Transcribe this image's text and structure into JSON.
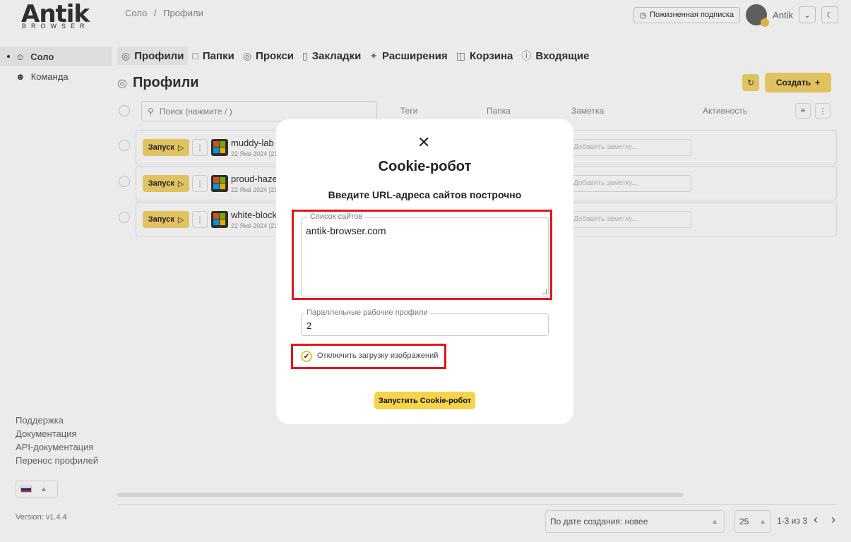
{
  "logo": {
    "word": "Antik",
    "sub": "BROWSER"
  },
  "breadcrumb": {
    "first": "Соло",
    "sep": "/",
    "second": "Профили"
  },
  "header": {
    "subscription_label": "Пожизненная подписка",
    "user_name": "Antik"
  },
  "sidebar": {
    "items": [
      {
        "label": "Соло",
        "icon": "user-icon"
      },
      {
        "label": "Команда",
        "icon": "team-icon"
      }
    ],
    "links": [
      "Поддержка",
      "Документация",
      "API-документация",
      "Перенос профилей"
    ],
    "version": "Version: v1.4.4"
  },
  "tabs": [
    {
      "label": "Профили",
      "icon": "fingerprint-icon"
    },
    {
      "label": "Папки",
      "icon": "folder-icon"
    },
    {
      "label": "Прокси",
      "icon": "globe-icon"
    },
    {
      "label": "Закладки",
      "icon": "bookmark-icon"
    },
    {
      "label": "Расширения",
      "icon": "puzzle-icon"
    },
    {
      "label": "Корзина",
      "icon": "trash-icon"
    },
    {
      "label": "Входящие",
      "icon": "info-icon"
    }
  ],
  "page": {
    "title": "Профили",
    "create_label": "Создать",
    "search_placeholder": "Поиск (нажмите / )",
    "columns": {
      "tags": "Теги",
      "folder": "Папка",
      "note": "Заметка",
      "activity": "Активность"
    }
  },
  "profiles": [
    {
      "name": "muddy-lab",
      "date": "22 Янв 2024 [21",
      "run": "Запуск",
      "note_placeholder": "Добавить заметку..."
    },
    {
      "name": "proud-haze",
      "date": "22 Янв 2024 [21",
      "run": "Запуск",
      "note_placeholder": "Добавить заметку..."
    },
    {
      "name": "white-block",
      "date": "22 Янв 2024 [21",
      "run": "Запуск",
      "note_placeholder": "Добавить заметку..."
    }
  ],
  "footer": {
    "sort": "По дате создания: новее",
    "per_page": "25",
    "range": "1-3 из 3"
  },
  "modal": {
    "title": "Cookie-робот",
    "subtitle": "Введите URL-адреса сайтов построчно",
    "sites_label": "Список сайтов",
    "sites_value": "antik-browser.com",
    "parallel_label": "Параллельные рабочие профили",
    "parallel_value": "2",
    "disable_images_label": "Отключить загрузку изображений",
    "disable_images_checked": true,
    "start_label": "Запустить Cookie-робот"
  },
  "colors": {
    "accent": "#f3d36a",
    "highlight": "#e0171f"
  }
}
